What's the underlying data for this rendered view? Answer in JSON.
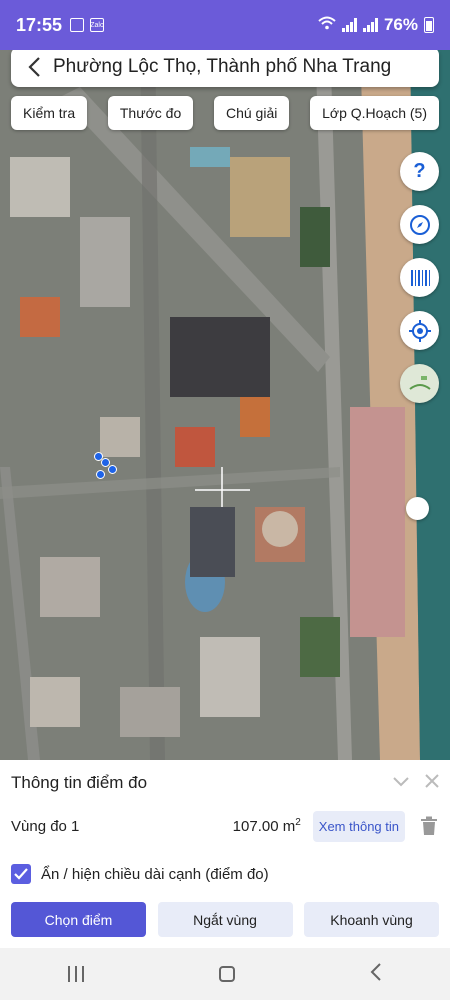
{
  "status_bar": {
    "time": "17:55",
    "app_icons": [
      "image-icon",
      "zalo-icon"
    ],
    "zalo_text": "Zalo",
    "battery": "76%"
  },
  "search": {
    "title": "Phường Lộc Thọ, Thành phố Nha Trang"
  },
  "top_buttons": [
    "Kiểm tra",
    "Thước đo",
    "Chú giải",
    "Lớp Q.Hoạch (5)"
  ],
  "tools": [
    "help-icon",
    "compass-icon",
    "barcode-icon",
    "locate-icon",
    "map-layer-icon"
  ],
  "panel": {
    "title": "Thông tin điểm đo",
    "area_name": "Vùng đo 1",
    "area_value": "107.00 m",
    "area_unit_sup": "2",
    "view_info": "Xem thông tin",
    "checkbox_label": "Ẩn / hiện chiều dài cạnh (điểm đo)",
    "checkbox_checked": true,
    "actions": [
      "Chọn điểm",
      "Ngắt vùng",
      "Khoanh vùng"
    ]
  },
  "colors": {
    "accent": "#5457d6",
    "status_bar": "#6b5bd9",
    "point": "#1e63e8"
  }
}
